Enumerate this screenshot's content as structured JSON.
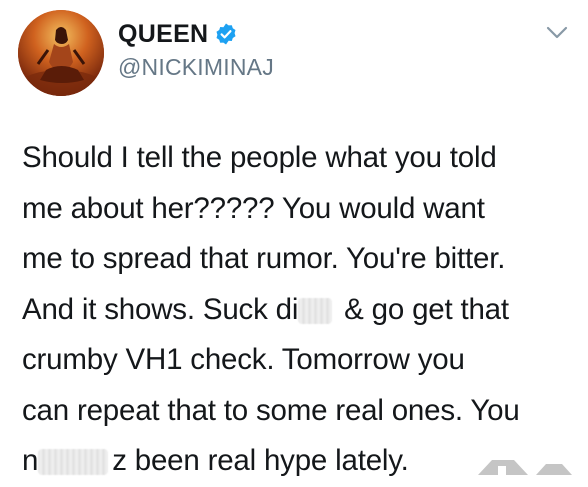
{
  "tweet": {
    "display_name": "QUEEN",
    "handle": "@NICKIMINAJ",
    "verified": true,
    "avatar_icon": "profile-avatar",
    "menu_icon": "chevron-down-icon",
    "accent_color": "#1da1f2",
    "lines": [
      "Should I tell the people what you told",
      "me about her????? You would want",
      "me to spread that rumor. You're bitter.",
      {
        "before": "And it shows. Suck di",
        "after": " & go get that"
      },
      "crumby VH1 check. Tomorrow you",
      "can repeat that to some real ones. You",
      {
        "before": "n",
        "after": "z been real hype lately."
      }
    ]
  }
}
